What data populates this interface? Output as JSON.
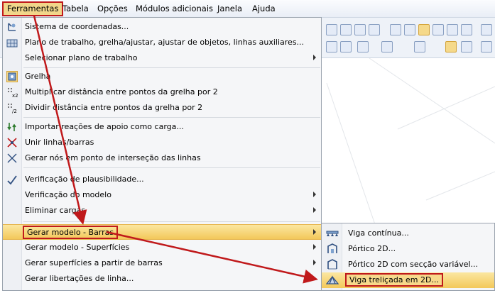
{
  "menubar": {
    "items": [
      "Ferramentas",
      "Tabela",
      "Opções",
      "Módulos adicionais",
      "Janela",
      "Ajuda"
    ]
  },
  "tools_menu": {
    "items": [
      {
        "label": "Sistema de coordenadas...",
        "icon": "coordinate-system-icon"
      },
      {
        "label": "Plano de trabalho, grelha/ajustar, ajustar de objetos, linhas auxiliares...",
        "icon": "work-plane-icon"
      },
      {
        "label": "Selecionar plano de trabalho",
        "icon": "",
        "submenu": true
      },
      {
        "label": "Grelha",
        "icon": "grid-icon",
        "checked": true
      },
      {
        "label": "Multiplicar distância entre pontos da grelha por 2",
        "icon": "grid-multiply-icon"
      },
      {
        "label": "Dividir distância entre pontos da grelha por 2",
        "icon": "grid-divide-icon"
      },
      {
        "label": "Importar reações de apoio como carga...",
        "icon": "import-reactions-icon"
      },
      {
        "label": "Unir linhas/barras",
        "icon": "join-lines-icon"
      },
      {
        "label": "Gerar nós em ponto de interseção das linhas",
        "icon": "intersection-nodes-icon"
      },
      {
        "label": "Verificação de plausibilidade...",
        "icon": "plausibility-check-icon"
      },
      {
        "label": "Verificação do modelo",
        "icon": "",
        "submenu": true
      },
      {
        "label": "Eliminar cargas",
        "icon": "",
        "submenu": true
      },
      {
        "label": "Gerar modelo - Barras",
        "icon": "",
        "submenu": true,
        "highlighted": true
      },
      {
        "label": "Gerar modelo - Superfícies",
        "icon": "",
        "submenu": true
      },
      {
        "label": "Gerar superfícies a partir de barras",
        "icon": "",
        "submenu": true
      },
      {
        "label": "Gerar libertações de linha...",
        "icon": ""
      }
    ]
  },
  "submenu": {
    "items": [
      {
        "label": "Viga contínua...",
        "icon": "continuous-beam-icon"
      },
      {
        "label": "Pórtico 2D...",
        "icon": "frame-2d-icon"
      },
      {
        "label": "Pórtico 2D com secção variável...",
        "icon": "tapered-frame-icon"
      },
      {
        "label": "Viga treliçada em 2D...",
        "icon": "truss-2d-icon",
        "highlighted": true
      }
    ]
  },
  "colors": {
    "annotation_red": "#c0191b",
    "highlight": "#f3c85a",
    "menu_bg": "#f5f6f8"
  }
}
